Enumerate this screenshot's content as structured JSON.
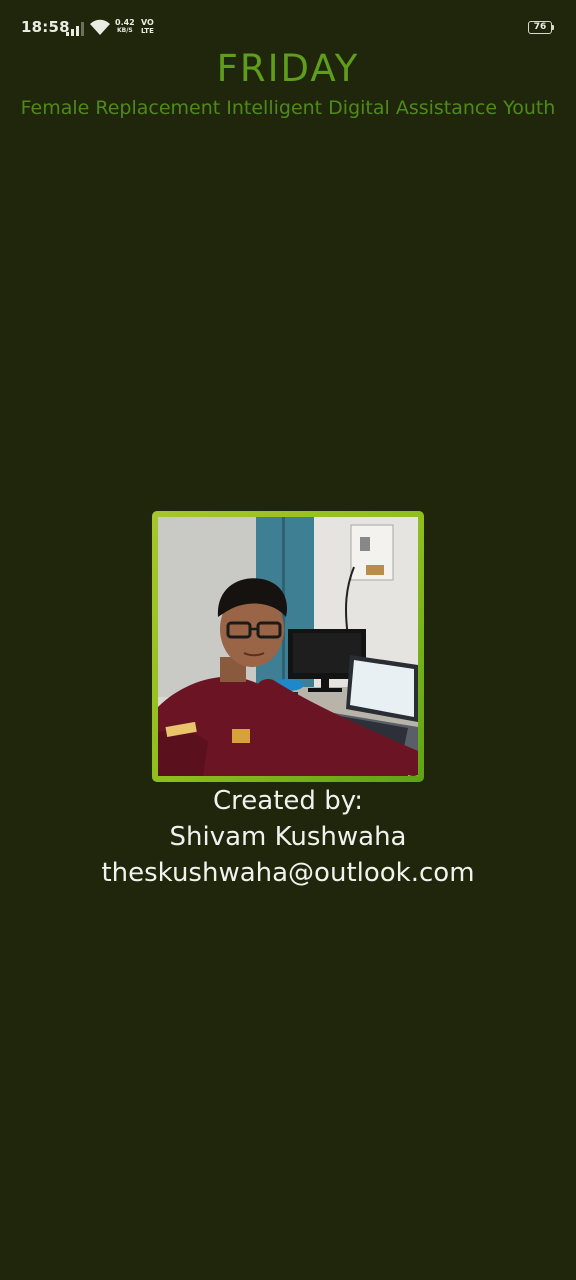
{
  "status_bar": {
    "time": "18:58",
    "net_speed_value": "0.42",
    "net_speed_unit": "KB/S",
    "volte_top": "VO",
    "volte_bottom": "LTE",
    "battery": "76"
  },
  "header": {
    "title": "FRIDAY",
    "subtitle": "Female Replacement Intelligent Digital Assistance Youth"
  },
  "credits": {
    "label": "Created by:",
    "name": "Shivam Kushwaha",
    "email": "theskushwaha@outlook.com"
  },
  "colors": {
    "background": "#1f260b",
    "title": "#5f9d1c",
    "frame": "#8fbf1d"
  },
  "icons": [
    "signal-icon",
    "wifi-icon",
    "battery-icon"
  ]
}
